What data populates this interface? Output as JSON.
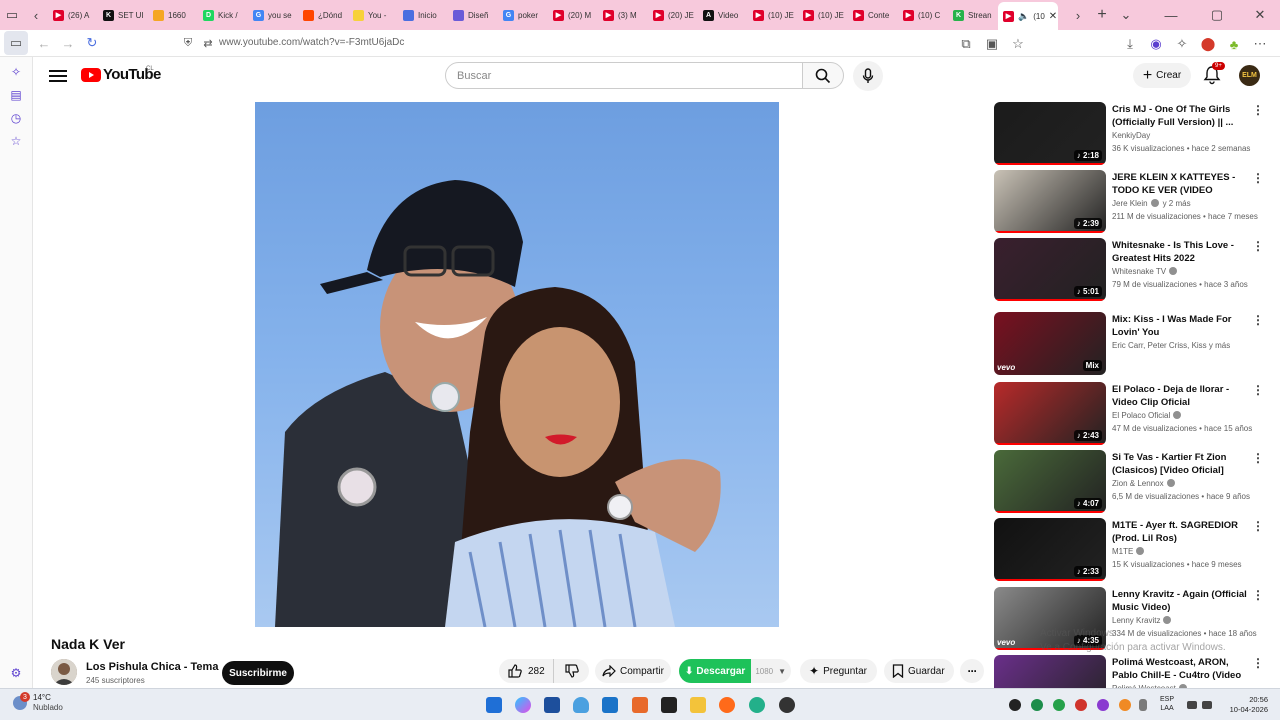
{
  "browser": {
    "tabs": [
      {
        "label": "(26) A",
        "color": "#e0002b",
        "glyph": "▶"
      },
      {
        "label": "SET UI",
        "color": "#111111",
        "glyph": "K"
      },
      {
        "label": "1660",
        "color": "#f5a623",
        "glyph": ""
      },
      {
        "label": "Kick /",
        "color": "#1ed760",
        "glyph": "D"
      },
      {
        "label": "you se",
        "color": "#4285f4",
        "glyph": "G"
      },
      {
        "label": "¿Dónd",
        "color": "#ff4500",
        "glyph": ""
      },
      {
        "label": "You -",
        "color": "#f7d13a",
        "glyph": ""
      },
      {
        "label": "Inicio",
        "color": "#4a6ee0",
        "glyph": ""
      },
      {
        "label": "Diseñ",
        "color": "#6a5bd8",
        "glyph": ""
      },
      {
        "label": "poker",
        "color": "#4285f4",
        "glyph": "G"
      },
      {
        "label": "(20) M",
        "color": "#e0002b",
        "glyph": "▶"
      },
      {
        "label": "(3) M",
        "color": "#e0002b",
        "glyph": "▶"
      },
      {
        "label": "(20) JE",
        "color": "#e0002b",
        "glyph": "▶"
      },
      {
        "label": "Video",
        "color": "#111111",
        "glyph": "A"
      },
      {
        "label": "(10) JE",
        "color": "#e0002b",
        "glyph": "▶"
      },
      {
        "label": "(10) JE",
        "color": "#e0002b",
        "glyph": "▶"
      },
      {
        "label": "Conte",
        "color": "#e0002b",
        "glyph": "▶"
      },
      {
        "label": "(10) C",
        "color": "#e0002b",
        "glyph": "▶"
      },
      {
        "label": "Strean",
        "color": "#27b24a",
        "glyph": "K"
      }
    ],
    "active_tab": {
      "label": "(10",
      "close": "✕"
    },
    "url": "www.youtube.com/watch?v=-F3mtU6jaDc",
    "accent": "#f7c9dc"
  },
  "youtube": {
    "logo_text": "YouTube",
    "region": "CL",
    "search_placeholder": "Buscar",
    "create_label": "Crear",
    "notifications_badge": "9+",
    "avatar_initials": "ELM"
  },
  "video": {
    "title": "Nada K Ver",
    "channel": "Los Pishula Chica - Tema",
    "subscribers": "245 suscriptores",
    "subscribe_label": "Suscribirme",
    "likes": "282",
    "share_label": "Compartir",
    "download_label": "Descargar",
    "download_quality": "1080",
    "ask_label": "Preguntar",
    "save_label": "Guardar"
  },
  "recommendations": [
    {
      "title": "Cris MJ - One Of The Girls (Officially Full Version) || ...",
      "channel": "KenkiyDay",
      "verified": false,
      "stats": "36 K visualizaciones • hace 2 semanas",
      "duration": "♪ 2:18",
      "thumb": "#1b1b1b",
      "progress": 1.0,
      "vevo": false
    },
    {
      "title": "JERE KLEIN X KATTEYES - TODO KE VER (VIDEO OFICIAL)",
      "channel": "Jere Klein",
      "verified": true,
      "channel_extra": "y 2 más",
      "stats": "211 M de visualizaciones • hace 7 meses",
      "duration": "♪ 2:39",
      "thumb": "#c9c2b6",
      "progress": 1.0,
      "vevo": false
    },
    {
      "title": "Whitesnake - Is This Love - Greatest Hits 2022",
      "channel": "Whitesnake TV",
      "verified": true,
      "stats": "79 M de visualizaciones • hace 3 años",
      "duration": "♪ 5:01",
      "thumb": "#3a1f2e",
      "progress": 1.0,
      "vevo": false
    },
    {
      "title": "Mix: Kiss - I Was Made For Lovin' You",
      "channel": "Eric Carr, Peter Criss, Kiss y más",
      "verified": false,
      "stats": "",
      "duration": "Mix",
      "thumb": "#7a1020",
      "progress": 0,
      "vevo": true
    },
    {
      "title": "El Polaco - Deja de llorar - Video Clip Oficial",
      "channel": "El Polaco Oficial",
      "verified": true,
      "stats": "47 M de visualizaciones • hace 15 años",
      "duration": "♪ 2:43",
      "thumb": "#b82a2a",
      "progress": 1.0,
      "vevo": false
    },
    {
      "title": "Si Te Vas - Kartier Ft Zion (Clasicos) [Video Oficial]",
      "channel": "Zion & Lennox",
      "verified": true,
      "stats": "6,5 M de visualizaciones • hace 9 años",
      "duration": "♪ 4:07",
      "thumb": "#4a6a3a",
      "progress": 1.0,
      "vevo": false
    },
    {
      "title": "M1TE - Ayer ft. SAGREDIOR (Prod. Lil Ros)",
      "channel": "M1TE",
      "verified": true,
      "stats": "15 K visualizaciones • hace 9 meses",
      "duration": "♪ 2:33",
      "thumb": "#111111",
      "progress": 1.0,
      "vevo": false
    },
    {
      "title": "Lenny Kravitz - Again (Official Music Video)",
      "channel": "Lenny Kravitz",
      "verified": true,
      "stats": "334 M de visualizaciones • hace 18 años",
      "duration": "♪ 4:35",
      "thumb": "#8a8a8a",
      "progress": 1.0,
      "vevo": true
    },
    {
      "title": "Polimá Westcoast, ARON, Pablo Chill-E - Cu4tro (Video Oficial)",
      "channel": "Polimá Westcoast",
      "verified": true,
      "stats": "",
      "duration": "",
      "thumb": "#6a2f8a",
      "progress": 0,
      "vevo": false
    }
  ],
  "windows_activation": {
    "line1": "Activar Windows",
    "line2": "Ve a Configuración para activar Windows."
  },
  "taskbar": {
    "weather_temp": "14°C",
    "weather_condition": "Nublado",
    "weather_badge": "3",
    "lang_top": "ESP",
    "lang_bottom": "LAA",
    "time": "20:56",
    "date": "10-04-2026"
  }
}
